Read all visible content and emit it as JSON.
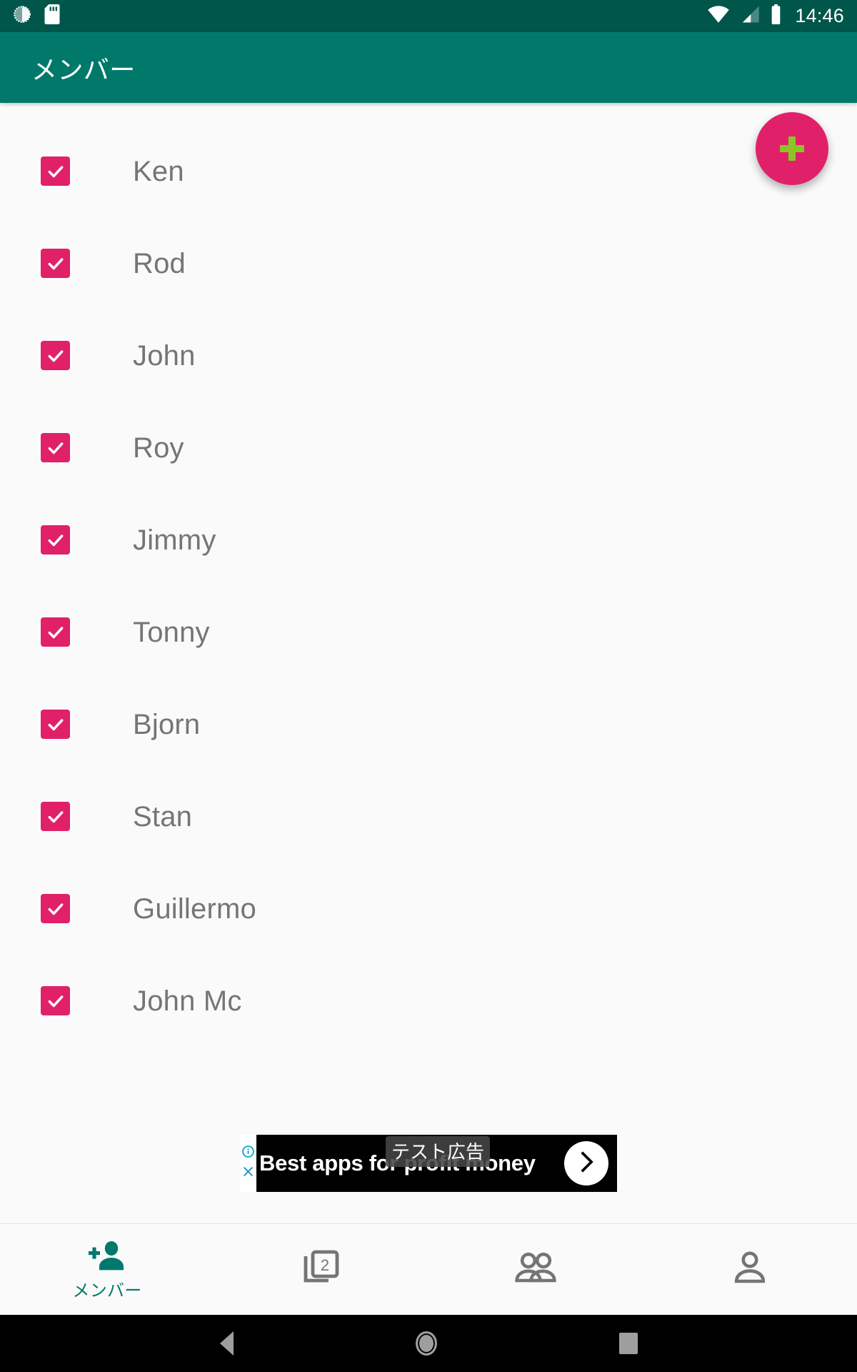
{
  "status_bar": {
    "icons": [
      "settings-circle-icon",
      "sd-card-icon",
      "wifi-icon",
      "cellular-signal-icon",
      "battery-icon"
    ],
    "time": "14:46",
    "background_color": "#00564b"
  },
  "app_bar": {
    "title": "メンバー",
    "background_color": "#00796b",
    "text_color": "#ffffff"
  },
  "fab": {
    "icon": "plus-icon",
    "background_color": "#e0216a",
    "icon_color": "#8bc525"
  },
  "members": [
    {
      "name": "Ken",
      "checked": true
    },
    {
      "name": "Rod",
      "checked": true
    },
    {
      "name": "John",
      "checked": true
    },
    {
      "name": "Roy",
      "checked": true
    },
    {
      "name": "Jimmy",
      "checked": true
    },
    {
      "name": "Tonny",
      "checked": true
    },
    {
      "name": "Bjorn",
      "checked": true
    },
    {
      "name": "Stan",
      "checked": true
    },
    {
      "name": "Guillermo",
      "checked": true
    },
    {
      "name": "John Mc",
      "checked": true
    }
  ],
  "checkbox_color": "#e0216a",
  "member_text_color": "#757575",
  "ad": {
    "headline": "Best apps for profit money",
    "test_label": "テスト広告",
    "info_icon": "info-icon",
    "close_icon": "close-icon",
    "cta_icon": "chevron-right-icon",
    "background_color": "#000000"
  },
  "bottom_nav": {
    "active_color": "#00796b",
    "inactive_color": "#757575",
    "items": [
      {
        "label": "メンバー",
        "icon": "person-add-icon",
        "active": true
      },
      {
        "label": "",
        "icon": "filter-2-icon",
        "active": false
      },
      {
        "label": "",
        "icon": "people-icon",
        "active": false
      },
      {
        "label": "",
        "icon": "person-icon",
        "active": false
      }
    ]
  },
  "system_nav": {
    "back": "back-triangle-icon",
    "home": "home-circle-icon",
    "recents": "recents-square-icon",
    "background_color": "#000000"
  }
}
